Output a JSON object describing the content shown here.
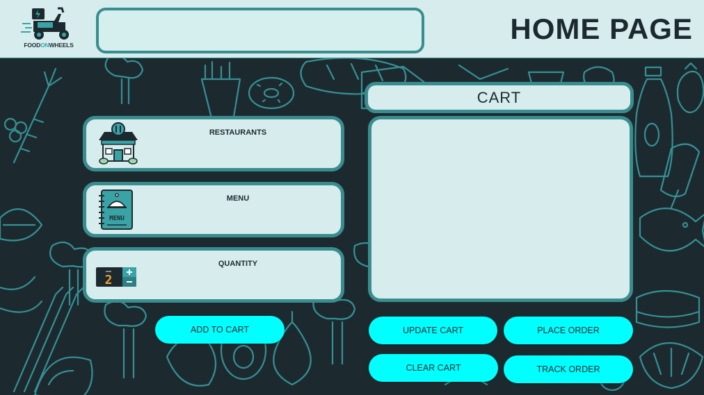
{
  "header": {
    "logo_text_food": "FOOD",
    "logo_text_on": "ON",
    "logo_text_wheels": "WHEELS",
    "search_value": "",
    "page_title": "HOME PAGE"
  },
  "cards": {
    "restaurants_label": "RESTAURANTS",
    "menu_label": "MENU",
    "menu_book_text": "MENU",
    "quantity_label": "QUANTITY",
    "quantity_value": "2"
  },
  "cart": {
    "title": "CART"
  },
  "buttons": {
    "add_to_cart": "ADD TO CART",
    "update_cart": "UPDATE CART",
    "place_order": "PLACE ORDER",
    "clear_cart": "CLEAR CART",
    "track_order": "TRACK ORDER"
  },
  "colors": {
    "background": "#1c2a30",
    "panel": "#d7eded",
    "border": "#3a8d8f",
    "button": "#00ffff",
    "text": "#1c2a30"
  }
}
